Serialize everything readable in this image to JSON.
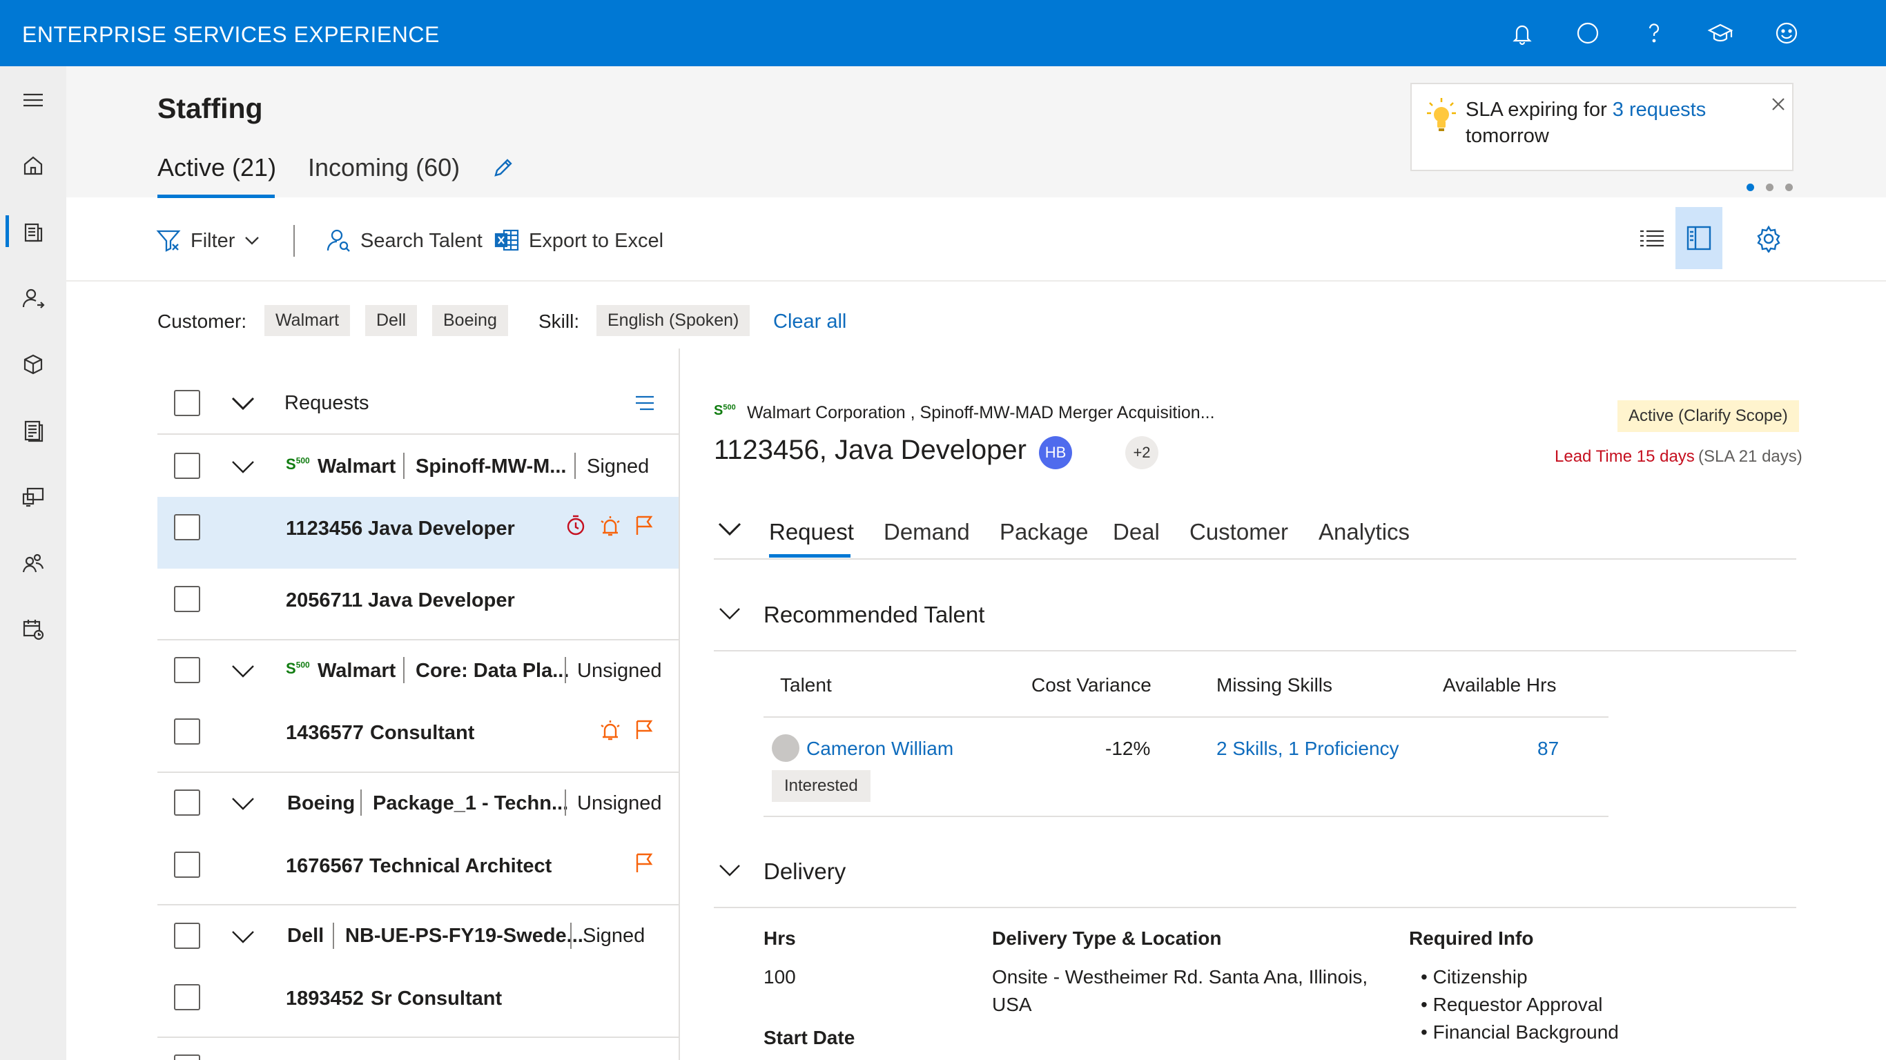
{
  "app_title": "ENTERPRISE SERVICES EXPERIENCE",
  "topbar_icons": [
    "bell-icon",
    "circle-icon",
    "help-icon",
    "learning-icon",
    "smiley-icon"
  ],
  "rail_icons": [
    "hamburger-icon",
    "home-icon",
    "staffing-icon",
    "person-icon",
    "package-icon",
    "report-icon",
    "device-icon",
    "people-icon",
    "calendar-icon"
  ],
  "header": {
    "title": "Staffing",
    "tabs": [
      {
        "label": "Active (21)"
      },
      {
        "label": "Incoming (60)"
      }
    ]
  },
  "notification": {
    "text_pre": "SLA expiring for ",
    "link": "3 requests",
    "text_post": "tomorrow"
  },
  "toolbar": {
    "filter": "Filter",
    "search": "Search Talent",
    "export": "Export to Excel"
  },
  "filters": {
    "customer_label": "Customer:",
    "customers": [
      "Walmart",
      "Dell",
      "Boeing"
    ],
    "skill_label": "Skill:",
    "skills": [
      "English (Spoken)"
    ],
    "clear_all": "Clear all"
  },
  "list": {
    "header": "Requests",
    "groups": [
      {
        "customer": "Walmart",
        "s500": true,
        "project": "Spinoff-MW-M...",
        "status": "Signed",
        "items": [
          {
            "id": "1123456",
            "role": "Java Developer",
            "selected": true
          },
          {
            "id": "2056711",
            "role": "Java Developer"
          }
        ]
      },
      {
        "customer": "Walmart",
        "s500": true,
        "project": "Core: Data Pla...",
        "status": "Unsigned",
        "items": [
          {
            "id": "1436577",
            "role": "Consultant"
          }
        ]
      },
      {
        "customer": "Boeing",
        "project": "Package_1 - Techn...",
        "status": "Unsigned",
        "items": [
          {
            "id": "1676567",
            "role": "Technical Architect"
          }
        ]
      },
      {
        "customer": "Dell",
        "project": "NB-UE-PS-FY19-Swede...",
        "status": "Signed",
        "items": [
          {
            "id": "1893452",
            "role": "Sr Consultant"
          }
        ]
      }
    ],
    "s500_label": "S500"
  },
  "detail": {
    "subtitle": "Walmart Corporation , Spinoff-MW-MAD Merger Acquisition...",
    "title": "1123456, Java Developer",
    "avatar": "HB",
    "more": "+2",
    "status": "Active (Clarify Scope)",
    "lead_time": "Lead Time 15 days",
    "sla": "(SLA 21 days)",
    "tabs": [
      "Request",
      "Demand",
      "Package",
      "Deal",
      "Customer",
      "Analytics"
    ],
    "recommended": {
      "title": "Recommended Talent",
      "columns": [
        "Talent",
        "Cost Variance",
        "Missing Skills",
        "Available Hrs"
      ],
      "rows": [
        {
          "name": "Cameron William",
          "variance": "-12%",
          "missing": "2 Skills, 1 Proficiency",
          "hrs": "87",
          "badge": "Interested"
        }
      ]
    },
    "delivery": {
      "title": "Delivery",
      "hrs_label": "Hrs",
      "hrs": "100",
      "start_label": "Start Date",
      "type_label": "Delivery Type & Location",
      "type_line1": "Onsite - Westheimer Rd. Santa Ana, Illinois,",
      "type_line2": "USA",
      "req_label": "Required Info",
      "req": [
        "Citizenship",
        "Requestor Approval",
        "Financial Background"
      ]
    }
  },
  "colors": {
    "brand": "#0078d4",
    "link": "#0f6cbd",
    "danger": "#c50f1f",
    "warn": "#f7630c",
    "badge": "#fff4ce"
  }
}
